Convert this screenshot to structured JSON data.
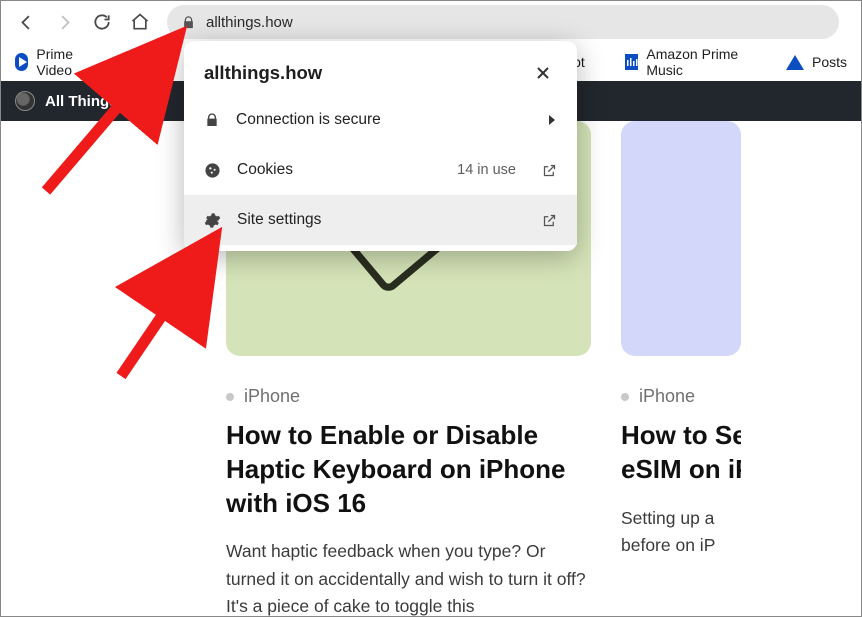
{
  "nav": {
    "url": "allthings.how"
  },
  "bookmarks": {
    "prime_video": "Prime Video",
    "prime_music": "Amazon Prime Music",
    "posts": "Posts"
  },
  "site_header": {
    "title": "All Things How"
  },
  "popup": {
    "host": "allthings.how",
    "secure": "Connection is secure",
    "cookies_label": "Cookies",
    "cookies_count": "14 in use",
    "settings": "Site settings"
  },
  "cards": [
    {
      "category": "iPhone",
      "title": "How to Enable or Disable Haptic Keyboard on iPhone with iOS 16",
      "excerpt": "Want haptic feedback when you type? Or turned it on accidentally and wish to turn it off? It's a piece of cake to toggle this"
    },
    {
      "category": "iPhone",
      "title": "How to Set up eSIM on iPhone",
      "excerpt": "Setting up an eSIM before on iPhone"
    }
  ]
}
